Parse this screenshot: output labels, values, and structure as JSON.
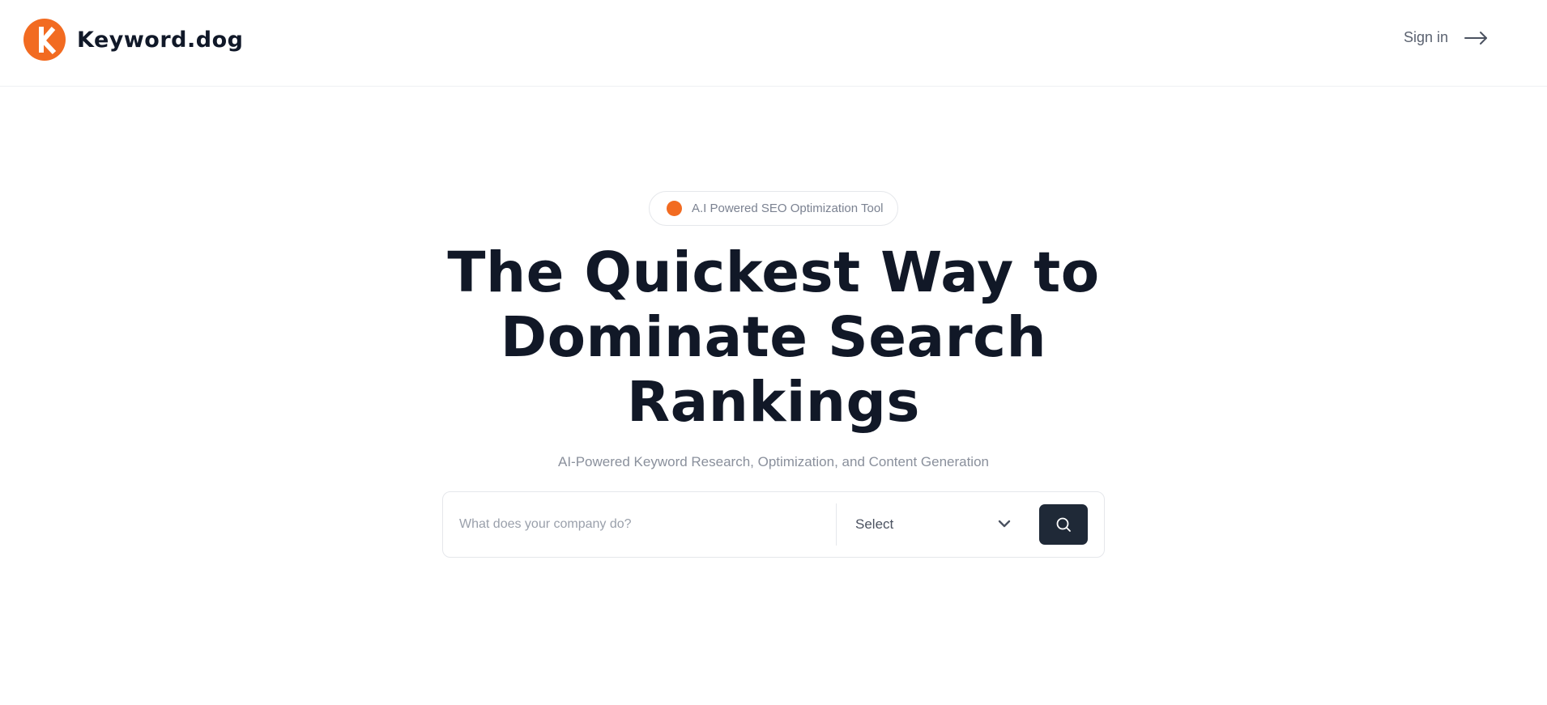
{
  "header": {
    "brand_name": "Keyword.dog",
    "logo_icon": "keyword-dog-logo",
    "signin_label": "Sign in",
    "signin_icon": "arrow-right-icon"
  },
  "hero": {
    "badge_text": "A.I Powered SEO Optimization Tool",
    "headline_lines": [
      "The Quickest Way to",
      "Dominate Search",
      "Rankings"
    ],
    "subheadline": "AI-Powered Keyword Research, Optimization, and Content Generation"
  },
  "search": {
    "input_placeholder": "What does your company do?",
    "input_value": "",
    "select_value": "Select",
    "button_icon": "search-icon"
  },
  "colors": {
    "accent": "#f26b21",
    "heading": "#111827",
    "button_bg": "#1f2937",
    "muted_text": "#8a909c"
  }
}
